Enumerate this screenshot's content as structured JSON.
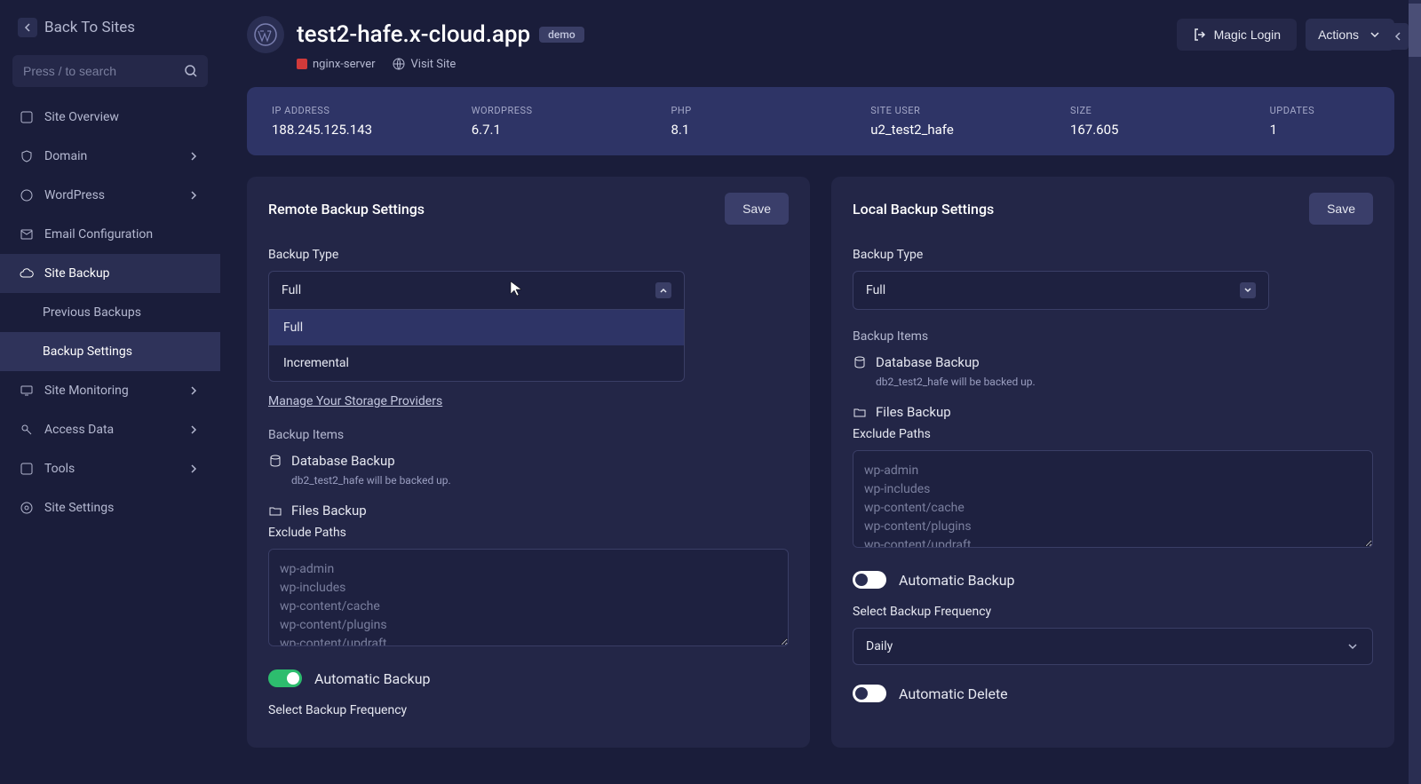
{
  "back_link": "Back To Sites",
  "search_placeholder": "Press / to search",
  "sidebar": {
    "items": [
      {
        "label": "Site Overview",
        "has_sub": false
      },
      {
        "label": "Domain",
        "has_sub": true
      },
      {
        "label": "WordPress",
        "has_sub": true
      },
      {
        "label": "Email Configuration",
        "has_sub": false
      },
      {
        "label": "Site Backup",
        "has_sub": false,
        "active": true
      },
      {
        "label": "Site Monitoring",
        "has_sub": true
      },
      {
        "label": "Access Data",
        "has_sub": true
      },
      {
        "label": "Tools",
        "has_sub": true
      },
      {
        "label": "Site Settings",
        "has_sub": false
      }
    ],
    "sub_items": [
      {
        "label": "Previous Backups"
      },
      {
        "label": "Backup Settings",
        "active": true
      }
    ]
  },
  "header": {
    "site_title": "test2-hafe.x-cloud.app",
    "demo_badge": "demo",
    "nginx": "nginx-server",
    "visit": "Visit Site",
    "magic_login": "Magic Login",
    "actions": "Actions"
  },
  "info": {
    "ip_label": "IP ADDRESS",
    "ip_val": "188.245.125.143",
    "wp_label": "WORDPRESS",
    "wp_val": "6.7.1",
    "php_label": "PHP",
    "php_val": "8.1",
    "user_label": "SITE USER",
    "user_val": "u2_test2_hafe",
    "size_label": "SIZE",
    "size_val": "167.605",
    "updates_label": "UPDATES",
    "updates_val": "1"
  },
  "remote": {
    "title": "Remote Backup Settings",
    "save": "Save",
    "type_label": "Backup Type",
    "type_value": "Full",
    "options": [
      "Full",
      "Incremental"
    ],
    "manage_link": "Manage Your Storage Providers",
    "items_label": "Backup Items",
    "db_label": "Database Backup",
    "db_sub": "db2_test2_hafe will be backed up.",
    "files_label": "Files Backup",
    "exclude_label": "Exclude Paths",
    "exclude_placeholder": "wp-admin\nwp-includes\nwp-content/cache\nwp-content/plugins\nwp-content/updraft",
    "auto_label": "Automatic Backup",
    "auto_on": true,
    "freq_label": "Select Backup Frequency"
  },
  "local": {
    "title": "Local Backup Settings",
    "save": "Save",
    "type_label": "Backup Type",
    "type_value": "Full",
    "items_label": "Backup Items",
    "db_label": "Database Backup",
    "db_sub": "db2_test2_hafe will be backed up.",
    "files_label": "Files Backup",
    "exclude_label": "Exclude Paths",
    "exclude_placeholder": "wp-admin\nwp-includes\nwp-content/cache\nwp-content/plugins\nwp-content/updraft",
    "auto_label": "Automatic Backup",
    "auto_on": false,
    "freq_label": "Select Backup Frequency",
    "freq_value": "Daily",
    "delete_label": "Automatic Delete",
    "delete_on": false
  }
}
